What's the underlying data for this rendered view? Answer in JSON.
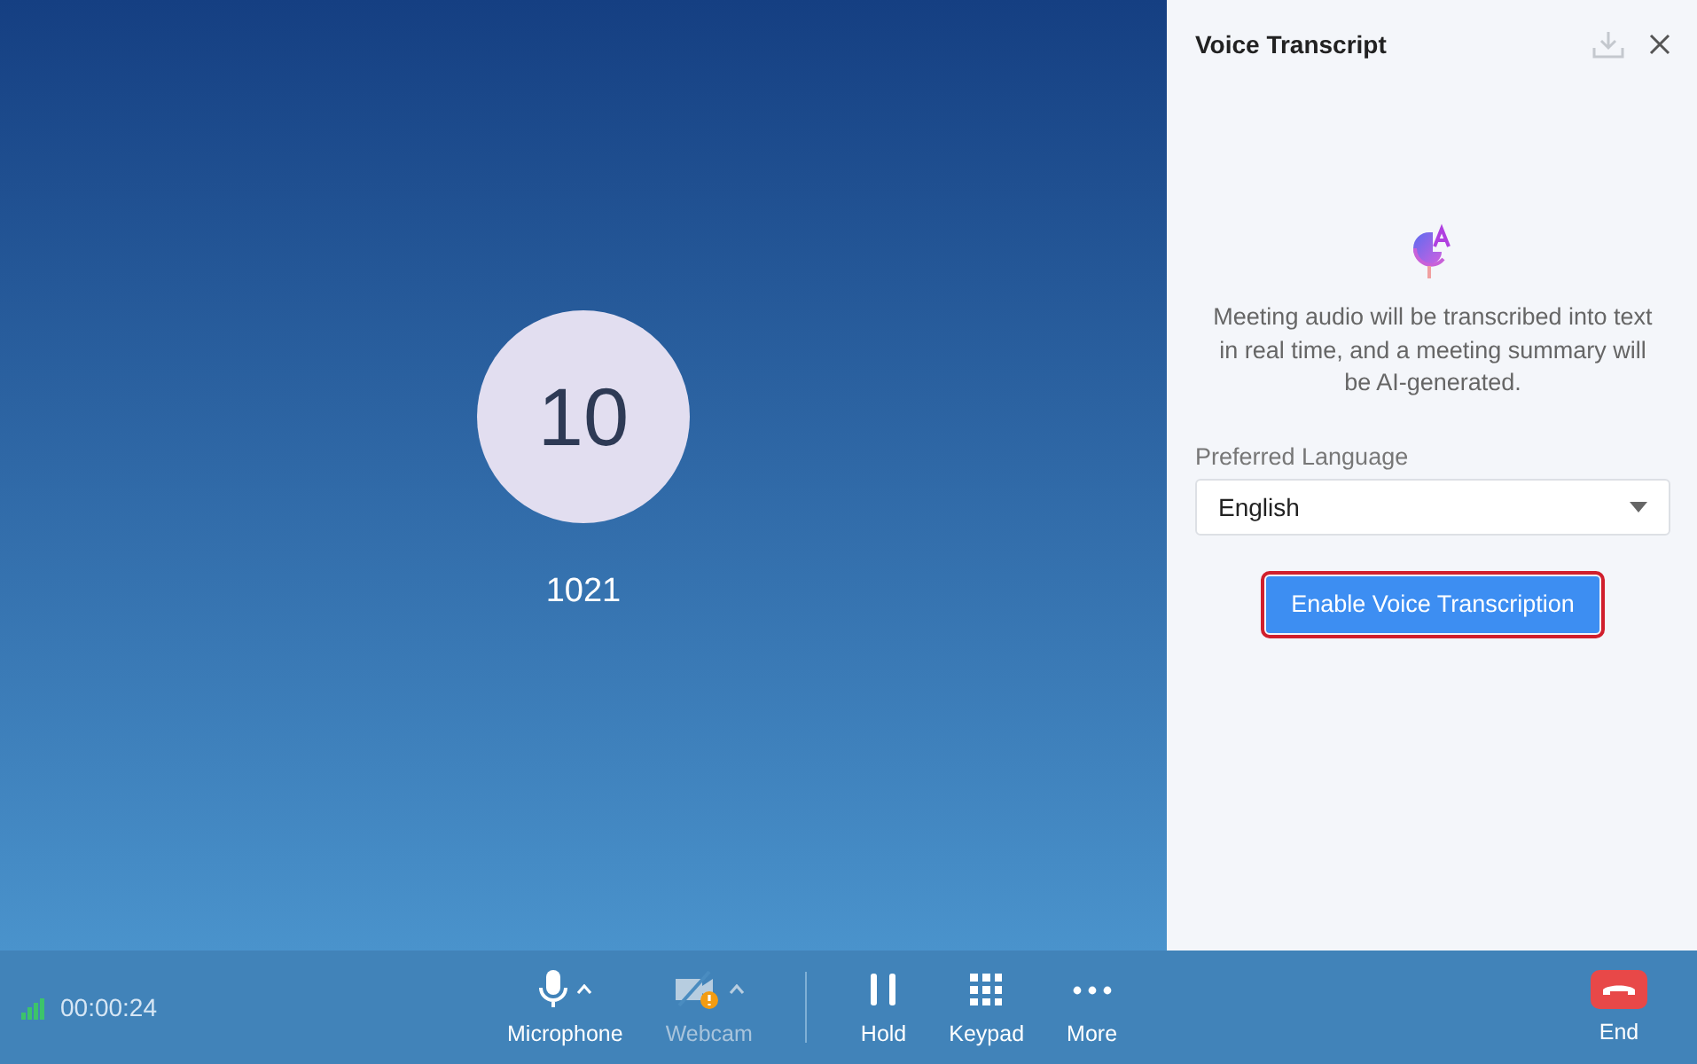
{
  "call": {
    "avatar_text": "10",
    "number": "1021"
  },
  "panel": {
    "title": "Voice Transcript",
    "description": "Meeting audio will be transcribed into text in real time, and a meeting summary will be AI-generated.",
    "language_label": "Preferred Language",
    "language": {
      "value": "English"
    },
    "enable_button": {
      "label": "Enable Voice Transcription",
      "highlighted": true
    }
  },
  "status": {
    "duration": "00:00:24"
  },
  "controls": [
    {
      "kind": "microphone",
      "label": "Microphone",
      "disabled": false,
      "has_menu": true
    },
    {
      "kind": "webcam",
      "label": "Webcam",
      "disabled": true,
      "has_menu": true
    },
    {
      "kind": "hold",
      "label": "Hold",
      "disabled": false,
      "has_menu": false
    },
    {
      "kind": "keypad",
      "label": "Keypad",
      "disabled": false,
      "has_menu": false
    },
    {
      "kind": "more",
      "label": "More",
      "disabled": false,
      "has_menu": false
    }
  ],
  "end_button": {
    "label": "End"
  }
}
